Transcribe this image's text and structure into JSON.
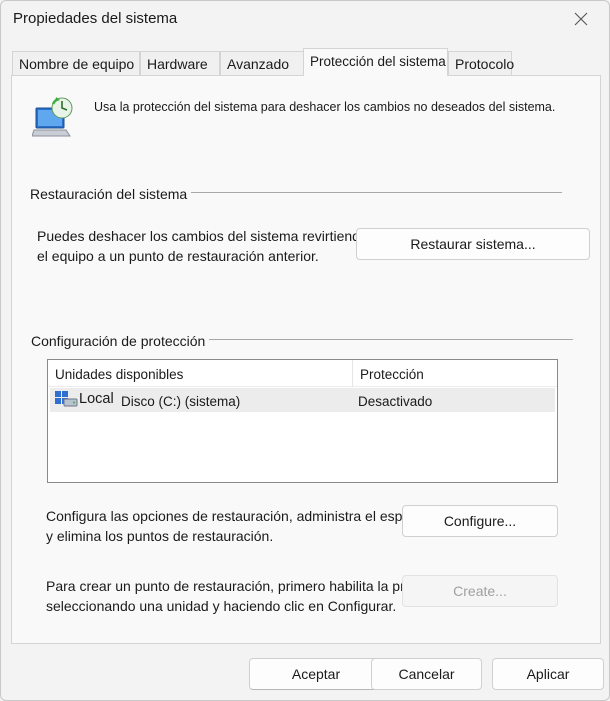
{
  "window": {
    "title": "Propiedades del sistema"
  },
  "tabs": [
    {
      "label": "Nombre de equipo"
    },
    {
      "label": "Hardware"
    },
    {
      "label": "Avanzado"
    },
    {
      "label": "Protección del sistema"
    },
    {
      "label": "Protocolo"
    }
  ],
  "intro": {
    "text": "Usa la protección del sistema para deshacer los cambios no deseados del sistema."
  },
  "restore": {
    "group_label": "Restauración del sistema",
    "line1": "Puedes deshacer los cambios del sistema revirtiendo",
    "line2": "el equipo a un punto de restauración anterior.",
    "button": "Restaurar sistema..."
  },
  "protection": {
    "group_label": "Configuración de protección",
    "columns": [
      "Unidades disponibles",
      "Protección"
    ],
    "rows": [
      {
        "drive_a": "Local",
        "drive_b": "Disco (C:) (sistema)",
        "status": "Desactivado"
      }
    ],
    "configure_line1": "Configura las opciones de restauración, administra el espacio en disco",
    "configure_line2": "y elimina los puntos de restauración.",
    "configure_button": "Configure...",
    "create_line1": "Para crear un punto de restauración, primero habilita la protección",
    "create_line2": "seleccionando una unidad y haciendo clic en Configurar.",
    "create_button": "Create..."
  },
  "footer": {
    "ok": "Aceptar",
    "cancel": "Cancelar",
    "apply": "Aplicar"
  },
  "colors": {
    "window_bg": "#f3f3f3",
    "panel_bg": "#f9f9f9",
    "selected_row": "#ececec",
    "disabled_text": "#a0a0a0"
  }
}
